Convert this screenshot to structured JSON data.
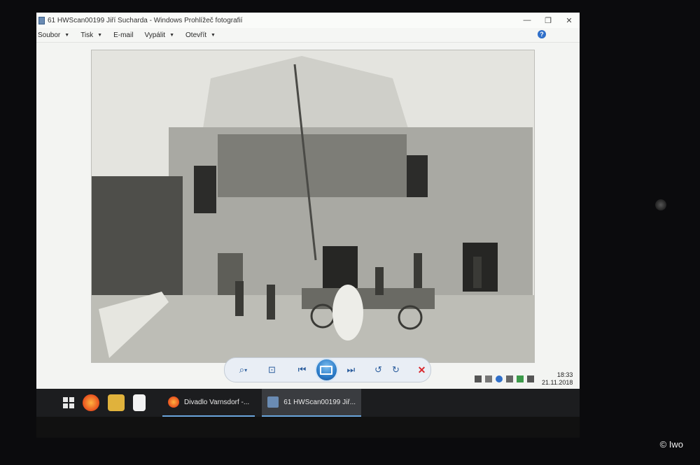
{
  "window": {
    "title": "61 HWScan00199 Jiří Sucharda - Windows Prohlížeč fotografií",
    "minimize": "—",
    "maximize": "❐",
    "close": "✕"
  },
  "menu": {
    "items": [
      {
        "label": "Soubor"
      },
      {
        "label": "Tisk"
      },
      {
        "label": "E-mail"
      },
      {
        "label": "Vypálit"
      },
      {
        "label": "Otevřít"
      }
    ],
    "caret": "▼",
    "help": "?"
  },
  "icons": {
    "zoom": "magnifier-icon",
    "fit": "fit-to-window-icon",
    "previous": "previous-icon",
    "slideshow": "slideshow-icon",
    "next": "next-icon",
    "rotate_left": "rotate-left-icon",
    "rotate_right": "rotate-right-icon",
    "delete": "delete-icon"
  },
  "controls": {
    "zoom_glyph": "⌕",
    "zoom_caret": "▾",
    "fit_glyph": "⊡",
    "prev_glyph": "⏮",
    "next_glyph": "⏭",
    "rotate_left_glyph": "↺",
    "rotate_right_glyph": "↻",
    "delete_glyph": "✕"
  },
  "tray": {
    "time": "18:33",
    "date": "21.11.2018"
  },
  "taskbar": {
    "items": [
      {
        "label": "Divadlo Varnsdorf -...",
        "active": false
      },
      {
        "label": "61 HWScan00199 Jiř...",
        "active": true
      }
    ]
  },
  "colors": {
    "accent": "#2a7bc8",
    "delete": "#d9262c",
    "taskbar": "#1c1d1f"
  },
  "watermark": "© Iwo"
}
